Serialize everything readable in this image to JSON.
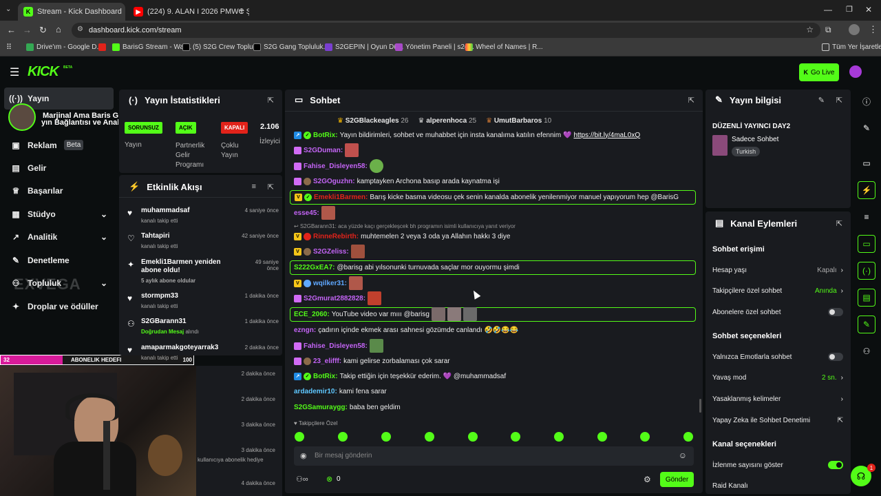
{
  "browser": {
    "tabs": [
      {
        "title": "Stream - Kick Dashboard",
        "active": true
      },
      {
        "title": "(224) 9. ALAN I 2026 PMWC ŞA",
        "active": false
      }
    ],
    "url": "dashboard.kick.com/stream",
    "bookmarks": [
      "Drive'ım - Google D...",
      "BarisG Stream - Wat...",
      "(5) S2G Crew Toplul...",
      "S2G Gang Topluluk...",
      "S2GEPIN | Oyun Dü...",
      "Yönetim Paneli | s2g...",
      "Wheel of Names | R..."
    ],
    "all_bookmarks": "Tüm Yer İşaretleri"
  },
  "topnav": {
    "logo": "KICK",
    "beta": "BETA",
    "go_live": "Go Live"
  },
  "sidebar": {
    "items": [
      {
        "label": "Yayın",
        "icon": "broadcast-icon"
      },
      {
        "label": "Reklam",
        "badge": "Beta",
        "icon": "ad-icon"
      },
      {
        "label": "Gelir",
        "icon": "revenue-icon"
      },
      {
        "label": "Başarılar",
        "icon": "trophy-icon"
      },
      {
        "label": "Stüdyo",
        "icon": "studio-icon"
      },
      {
        "label": "Analitik",
        "icon": "analytics-icon"
      },
      {
        "label": "Denetleme",
        "icon": "wrench-icon"
      },
      {
        "label": "Topluluk",
        "icon": "community-icon"
      },
      {
        "label": "Droplar ve ödüller",
        "icon": "gift-icon"
      }
    ],
    "overlay_text_1": "Marjinal Ama Baris G",
    "overlay_text_2": "yın Bağlantısı ve Anahta"
  },
  "webcam": {
    "sub_goal_current": "32",
    "sub_goal_label": "ABONELIK HEDEFI",
    "sub_goal_target": "100",
    "watermark": "EXVEGA"
  },
  "stats": {
    "title": "Yayın İstatistikleri",
    "cols": [
      {
        "badge": "SORUNSUZ",
        "badge_color": "#53fc18",
        "label": "Yayın"
      },
      {
        "badge": "AÇIK",
        "badge_color": "#53fc18",
        "label": "Partnerlik Gelir Programı"
      },
      {
        "badge": "KAPALI",
        "badge_color": "#e2231a",
        "label": "Çoklu Yayın"
      },
      {
        "value": "2.106",
        "label": "İzleyici"
      }
    ]
  },
  "activity": {
    "title": "Etkinlik Akışı",
    "events": [
      {
        "name": "muhammadsaf",
        "sub": "kanalı takip etti",
        "time": "4 saniye önce",
        "icon": "heart-icon"
      },
      {
        "name": "Tahtapiri",
        "sub": "kanalı takip etti",
        "time": "42 saniye önce",
        "icon": "heart-icon"
      },
      {
        "name": "Emekli1Barmen yeniden abone oldu!",
        "sub": "5 aylık abone oldular",
        "time": "49 saniye önce",
        "icon": "sparkle-icon"
      },
      {
        "name": "stormpm33",
        "sub": "kanalı takip etti",
        "time": "1 dakika önce",
        "icon": "heart-icon"
      },
      {
        "name": "S2GBarann31",
        "sub": "Doğrudan Mesaj",
        "sub2": " alındı",
        "time": "1 dakika önce",
        "icon": "users-icon"
      },
      {
        "name": "amaparmakgoteyarrak3",
        "sub": "kanalı takip etti",
        "time": "2 dakika önce",
        "icon": "heart-icon"
      }
    ],
    "hidden_times": [
      "2 dakika önce",
      "2 dakika önce",
      "3 dakika önce",
      "3 dakika önce",
      "4 dakika önce"
    ],
    "hidden_sub": "kullanıcıya abonelik hediye"
  },
  "chat": {
    "title": "Sohbet",
    "leaders": [
      {
        "name": "S2GBlackeagles",
        "count": "26"
      },
      {
        "name": "alperenhoca",
        "count": "25"
      },
      {
        "name": "UmutBarbaros",
        "count": "10"
      }
    ],
    "messages": [
      {
        "user": "BotRix:",
        "color": "#53fc18",
        "text": "Yayın bildirimleri, sohbet ve muhabbet için insta kanalıma katılın efennim 💜 ",
        "link": "https://bit.ly/4maL0xQ"
      },
      {
        "user": "S2GDuman:",
        "color": "#c364f5",
        "text": ""
      },
      {
        "user": "Fahise_Disleyen58:",
        "color": "#c364f5",
        "text": ""
      },
      {
        "user": "S2GOguzhn:",
        "color": "#c364f5",
        "text": "kamptayken Archona basıp arada kaynatma işi"
      },
      {
        "user": "Emekli1Barmen:",
        "color": "#e2231a",
        "text": "Barış kicke basma videosu çek senin kanalda abonelik yenilenmiyor manuel yapıyorum hep @BarisG"
      },
      {
        "user": "esse45:",
        "color": "#c364f5",
        "text": ""
      },
      {
        "reply": "S2GBarann31: aca yüzde kaçı gerçekleşcek bh programın isimli kullanıcıya yanıt veriyor"
      },
      {
        "user": "RinneRebirth:",
        "color": "#e2231a",
        "text": "muhtemelen 2 veya 3 oda ya Allahın hakkı 3 diye"
      },
      {
        "user": "S2GZeliss:",
        "color": "#c364f5",
        "text": ""
      },
      {
        "user": "S222GxEA7:",
        "color": "#53fc18",
        "text": "@barisg abi yılsonunki turnuvada saçlar mor ouyormu şimdi"
      },
      {
        "user": "wqilker31:",
        "color": "#5fa8ff",
        "text": ""
      },
      {
        "user": "S2Gmurat2882828:",
        "color": "#c364f5",
        "text": ""
      },
      {
        "user": "ECE_2060:",
        "color": "#53fc18",
        "text": "YouTube video var mııı @barisg"
      },
      {
        "user": "ezngn:",
        "color": "#c364f5",
        "text": "çadırın içinde ekmek arası sahnesi gözümde canlandı 🤣🤣😂😂"
      },
      {
        "user": "Fahise_Disleyen58:",
        "color": "#c364f5",
        "text": ""
      },
      {
        "user": "23_elifff:",
        "color": "#c364f5",
        "text": "kami gelirse zorbalaması çok sarar"
      },
      {
        "user": "BotRix:",
        "color": "#53fc18",
        "text": "Takip ettiğin için teşekkür ederim. 💜 @muhammadsaf"
      },
      {
        "user": "ardademir10:",
        "color": "#5fc8ff",
        "text": "kami fena sarar"
      },
      {
        "user": "S2GSamuraygg:",
        "color": "#53fc18",
        "text": "baba ben geldim"
      }
    ],
    "followers_only": "Takipçilere Özel",
    "placeholder": "Bir mesaj gönderin",
    "points": "0",
    "send_label": "Gönder"
  },
  "stream_info": {
    "title": "Yayın bilgisi",
    "stream_title": "DÜZENLİ YAYINCI DAY2",
    "category": "Sadece Sohbet",
    "tag": "Turkish"
  },
  "channel_actions": {
    "title": "Kanal Eylemleri",
    "chat_access": "Sohbet erişimi",
    "account_age": {
      "label": "Hesap yaşı",
      "value": "Kapalı"
    },
    "followers_only": {
      "label": "Takipçilere özel sohbet",
      "value": "Anında"
    },
    "subscribers_only": {
      "label": "Abonelere özel sohbet"
    },
    "chat_options": "Sohbet seçenekleri",
    "emote_only": {
      "label": "Yalnızca Emotlarla sohbet"
    },
    "slow_mode": {
      "label": "Yavaş mod",
      "value": "2 sn."
    },
    "banned_words": {
      "label": "Yasaklanmış kelimeler"
    },
    "ai_moderation": {
      "label": "Yapay Zeka ile Sohbet Denetimi"
    },
    "channel_options": "Kanal seçenekleri",
    "show_viewers": {
      "label": "İzlenme sayısını göster"
    },
    "raid": {
      "label": "Raid Kanalı"
    }
  },
  "support_badge": "1"
}
